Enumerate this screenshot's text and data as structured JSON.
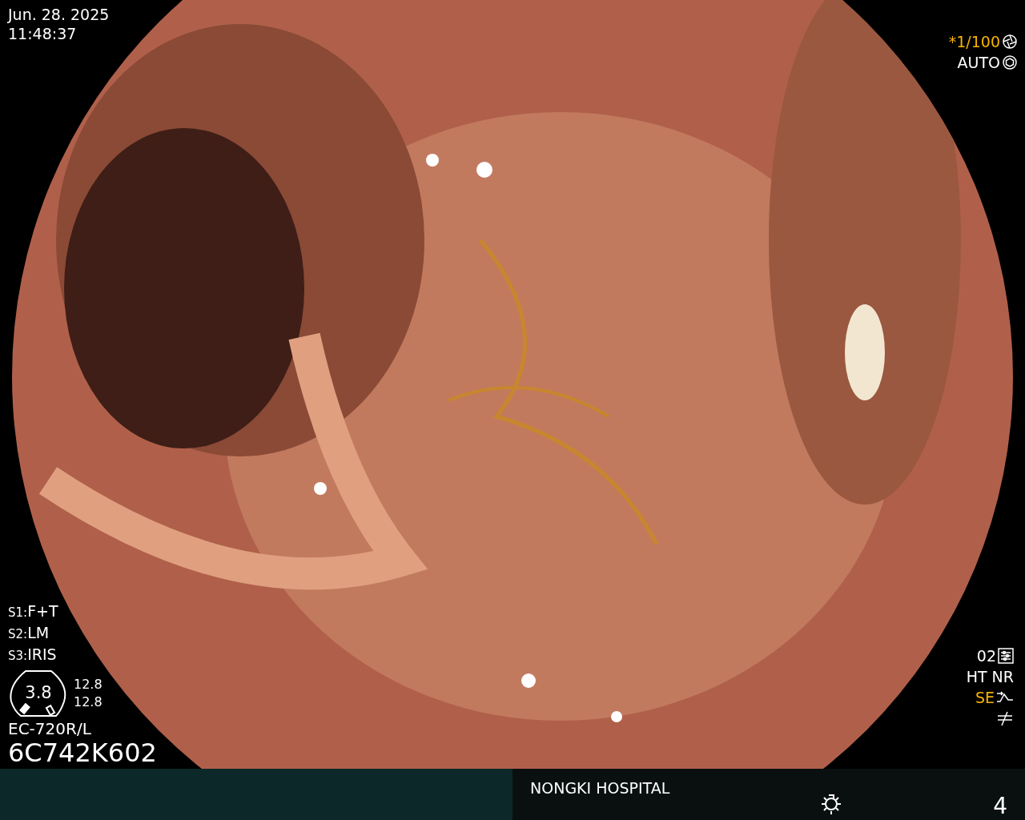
{
  "timestamp": {
    "date": "Jun. 28. 2025",
    "time": "11:48:37"
  },
  "exposure": [
    {
      "text": "*1/100",
      "highlighted": true,
      "kind": "shutter"
    },
    {
      "text": "AUTO",
      "highlighted": false,
      "kind": "iris"
    }
  ],
  "scope_settings": [
    {
      "key": "S1:",
      "value": "F+T"
    },
    {
      "key": "S2:",
      "value": "LM"
    },
    {
      "key": "S3:",
      "value": "IRIS"
    }
  ],
  "gauge": {
    "value": "3.8",
    "readings": [
      "12.8",
      "12.8"
    ]
  },
  "scope": {
    "model": "EC-720R/L",
    "serial": "6C742K602"
  },
  "image_modes": [
    {
      "text": "02",
      "highlighted": false,
      "kind": "preset"
    },
    {
      "text": "HT NR",
      "highlighted": false,
      "kind": "plain"
    },
    {
      "text": "SE",
      "highlighted": true,
      "kind": "enhance"
    },
    {
      "kind": "filter"
    }
  ],
  "status_bar": {
    "hospital": "NONGKI HOSPITAL",
    "counter": "4"
  }
}
